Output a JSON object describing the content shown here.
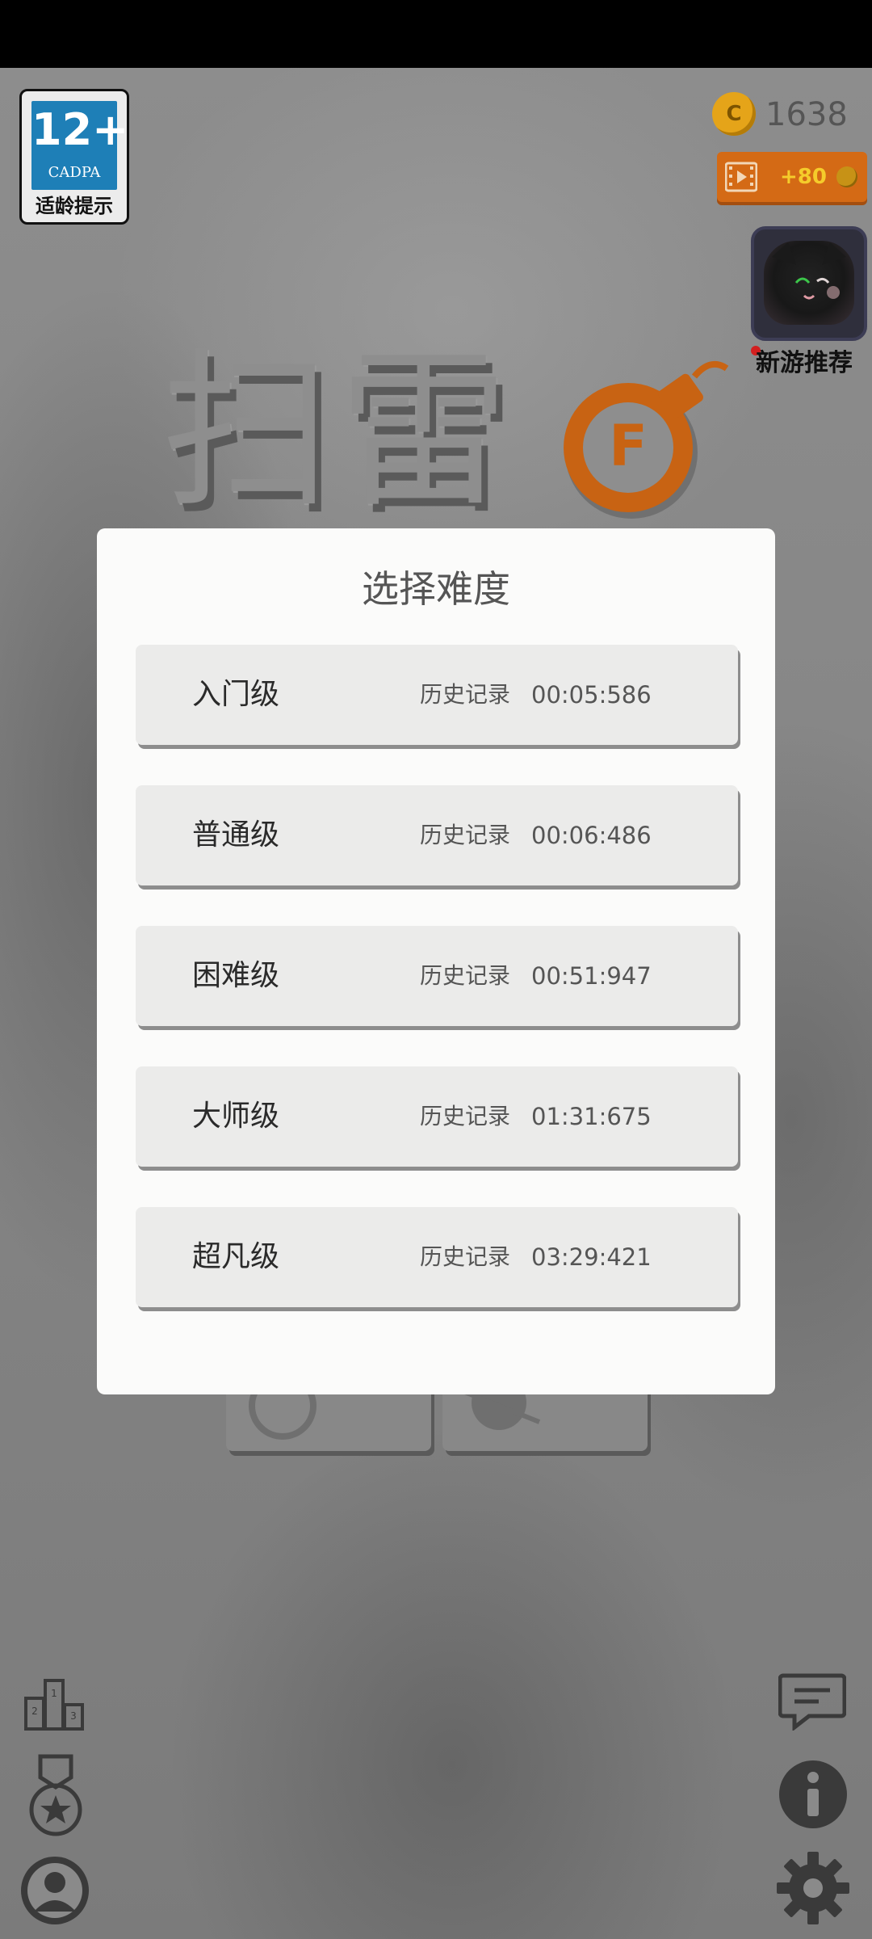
{
  "age_badge": {
    "rating": "12+",
    "org": "CADPA",
    "hint": "适龄提示"
  },
  "coins": {
    "count": "1638",
    "coin_symbol": "C"
  },
  "video_reward": {
    "label": "+80"
  },
  "promo": {
    "label": "新游推荐"
  },
  "title": {
    "text": "扫雷",
    "bomb_letter": "F"
  },
  "dialog": {
    "title": "选择难度",
    "record_label": "历史记录",
    "levels": [
      {
        "name": "入门级",
        "record": "00:05:586"
      },
      {
        "name": "普通级",
        "record": "00:06:486"
      },
      {
        "name": "困难级",
        "record": "00:51:947"
      },
      {
        "name": "大师级",
        "record": "01:31:675"
      },
      {
        "name": "超凡级",
        "record": "03:29:421"
      }
    ]
  },
  "icons": {
    "left": [
      "leaderboard-icon",
      "medal-icon",
      "profile-icon"
    ],
    "right": [
      "message-icon",
      "info-icon",
      "settings-icon"
    ]
  },
  "colors": {
    "accent_orange": "#d46a15",
    "dialog_bg": "#fbfbfa",
    "level_bg": "#ebebea"
  }
}
